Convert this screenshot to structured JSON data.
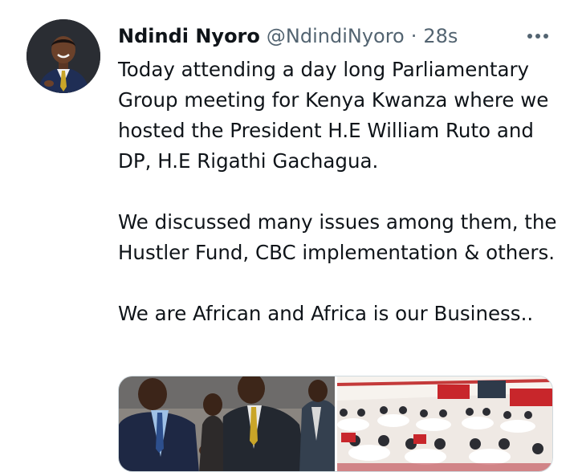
{
  "tweet": {
    "author_name": "Ndindi Nyoro",
    "author_handle": "@NdindiNyoro",
    "separator": "·",
    "timestamp": "28s",
    "paragraphs": [
      "Today attending a day long Parliamentary Group meeting for Kenya Kwanza where we hosted the President H.E William Ruto and DP, H.E Rigathi Gachagua.",
      "We discussed many issues among them, the Hustler Fund, CBC implementation & others.",
      "We are African and Africa is our Business.."
    ]
  },
  "icons": {
    "more": "more-options-icon",
    "avatar": "avatar"
  },
  "colors": {
    "text_primary": "#0f1419",
    "text_secondary": "#536471",
    "border": "#cfd9de"
  }
}
